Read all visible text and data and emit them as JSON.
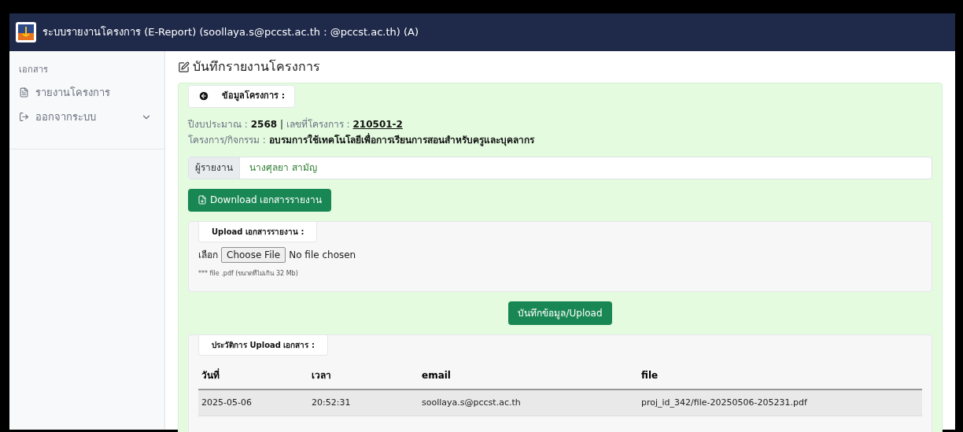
{
  "header": {
    "title": "ระบบรายงานโครงการ (E-Report) (soollaya.s@pccst.ac.th : @pccst.ac.th) (A)"
  },
  "sidebar": {
    "section": "เอกสาร",
    "items": [
      {
        "label": "รายงานโครงการ",
        "kind": "link"
      },
      {
        "label": "ออกจากระบบ",
        "kind": "menu",
        "expanded": false
      }
    ]
  },
  "page_title": "บันทึกรายงานโครงการ",
  "project": {
    "legend": "ข้อมูลโครงการ :",
    "year_label": "ปีงบประมาณ :",
    "year": "2568",
    "separator": "|",
    "number_label": "เลขที่โครงการ :",
    "number": "210501-2",
    "activity_label": "โครงการ/กิจกรรม :",
    "activity": "อบรมการใช้เทคโนโลยีเพื่อการเรียนการสอนสำหรับครูและบุคลากร"
  },
  "reporter": {
    "label": "ผู้รายงาน",
    "value": "นางศุลยา สามัญ"
  },
  "download_button": "Download เอกสารรายงาน",
  "upload": {
    "legend": "Upload เอกสารรายงาน :",
    "choose_label": "เลือก",
    "file_button": "Choose File",
    "file_status": "No file chosen",
    "hint": "*** file .pdf (ขนาดที่ไม่เกิน 32 Mb)"
  },
  "save_button": "บันทึกข้อมูล/Upload",
  "history": {
    "legend": "ประวัติการ Upload เอกสาร :",
    "columns": [
      "วันที่",
      "เวลา",
      "email",
      "file"
    ],
    "rows": [
      [
        "2025-05-06",
        "20:52:31",
        "soollaya.s@pccst.ac.th",
        "proj_id_342/file-20250506-205231.pdf"
      ]
    ]
  }
}
